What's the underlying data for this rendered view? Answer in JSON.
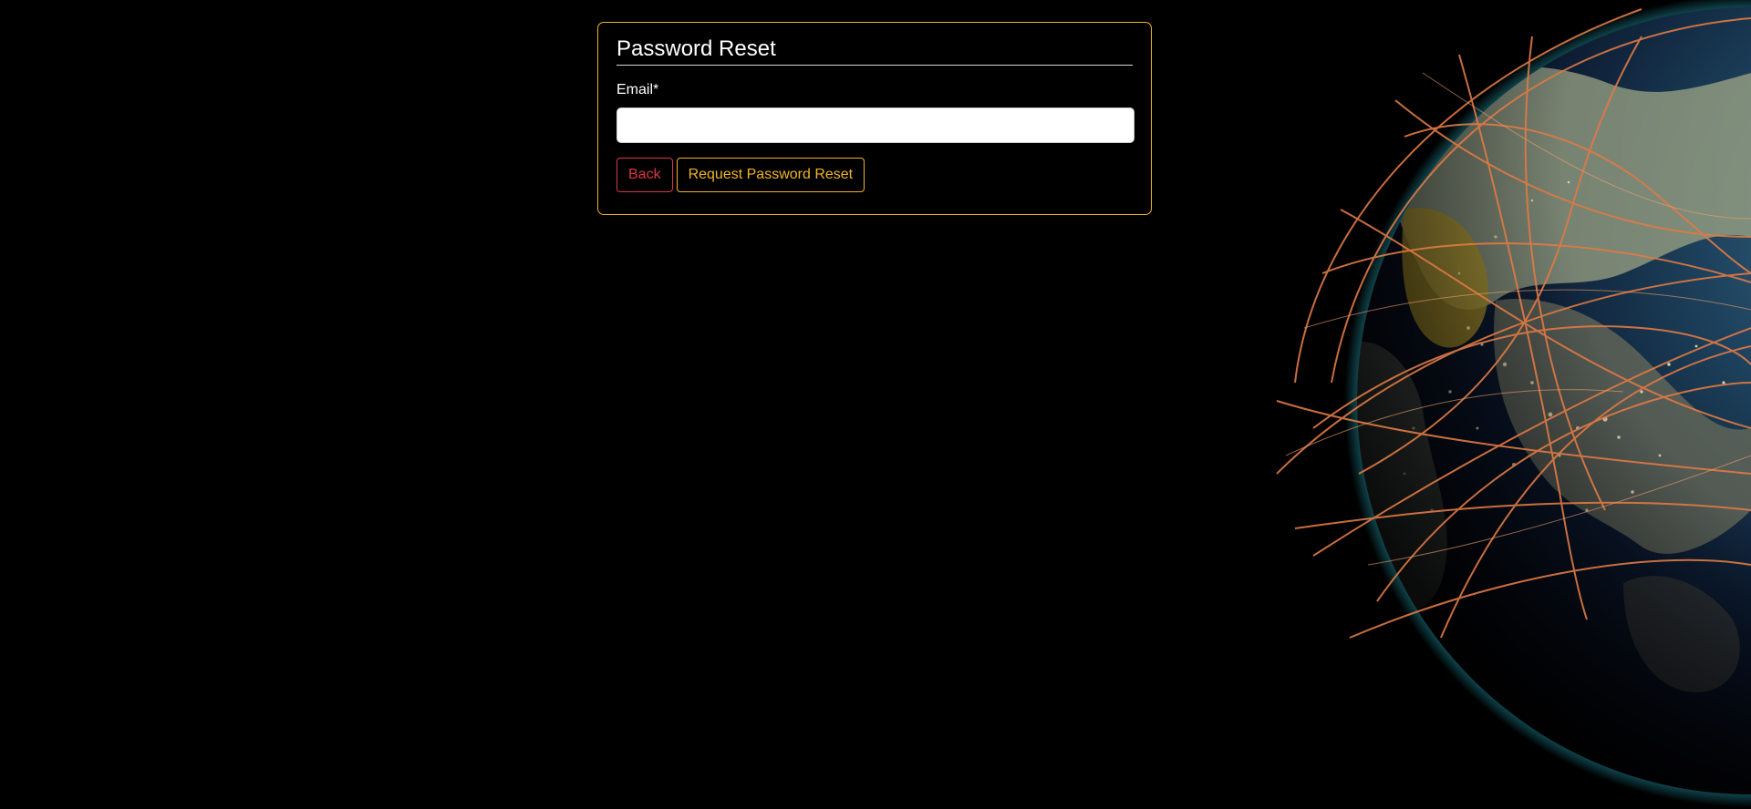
{
  "card": {
    "title": "Password Reset",
    "email_label": "Email*",
    "email_value": "",
    "back_label": "Back",
    "request_label": "Request Password Reset"
  },
  "background": {
    "image": "globe-with-network-arcs"
  },
  "colors": {
    "page_bg": "#000000",
    "accent": "#f0b429",
    "danger": "#dc3545",
    "arc": "#e07a45"
  }
}
